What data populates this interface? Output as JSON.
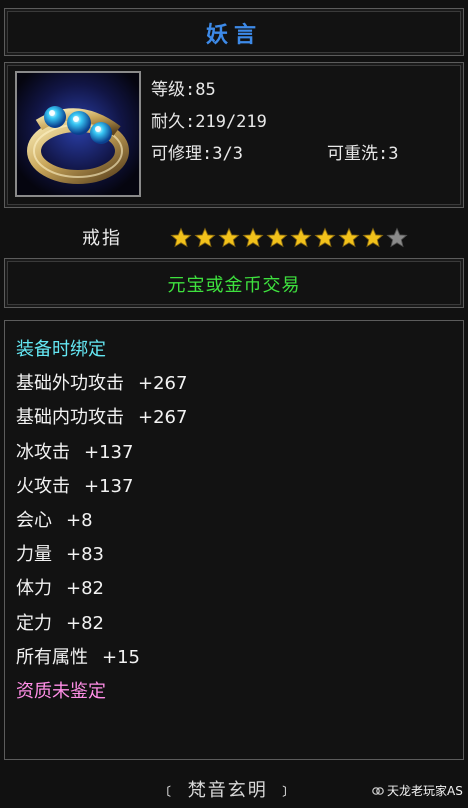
{
  "item": {
    "name": "妖言",
    "type": "戒指",
    "level": "等级:85",
    "durability": "耐久:219/219",
    "repair": "可修理:3/3",
    "rewash": "可重洗:3",
    "stars_filled": 9,
    "stars_total": 10,
    "trade": "元宝或金币交易"
  },
  "attributes": [
    {
      "label": "装备时绑定",
      "value": "",
      "style": "bound"
    },
    {
      "label": "基础外功攻击",
      "value": "+267",
      "style": "white"
    },
    {
      "label": "基础内功攻击",
      "value": "+267",
      "style": "white"
    },
    {
      "label": "冰攻击",
      "value": "+137",
      "style": "white"
    },
    {
      "label": "火攻击",
      "value": "+137",
      "style": "white"
    },
    {
      "label": "会心",
      "value": "+8",
      "style": "white"
    },
    {
      "label": "力量",
      "value": "+83",
      "style": "white"
    },
    {
      "label": "体力",
      "value": "+82",
      "style": "white"
    },
    {
      "label": "定力",
      "value": "+82",
      "style": "white"
    },
    {
      "label": "所有属性",
      "value": "+15",
      "style": "white"
    },
    {
      "label": "资质未鉴定",
      "value": "",
      "style": "pink"
    }
  ],
  "footer": {
    "set_name": "﹝ 梵音玄明 ﹞"
  },
  "watermark": "天龙老玩家AS",
  "colors": {
    "title": "#3d8ae8",
    "trade": "#3ee13e",
    "bound": "#64e6f2",
    "unidentified": "#ff8ee6",
    "star": "#f2c21b",
    "star_empty": "#8a8a8a"
  },
  "icons": [
    "ring-item-icon",
    "star-icon",
    "watermark-logo-icon"
  ]
}
